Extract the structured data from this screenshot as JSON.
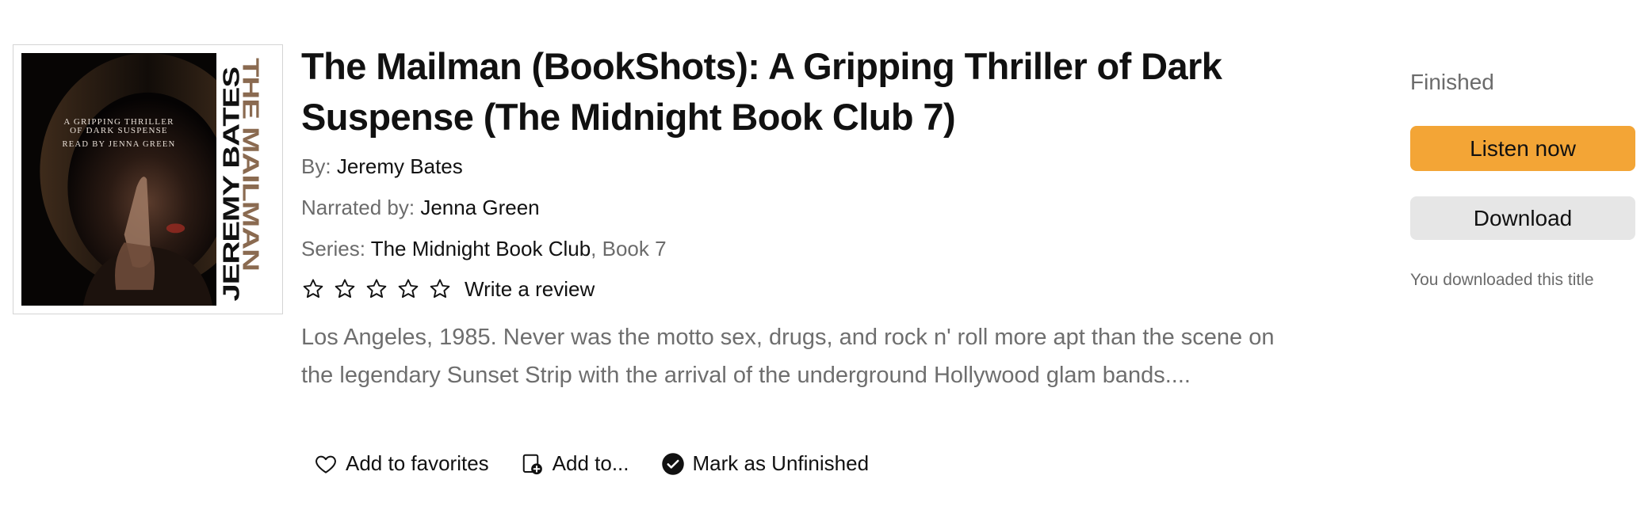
{
  "cover": {
    "tagline_line1": "A Gripping Thriller",
    "tagline_line2": "of Dark Suspense",
    "narrator_line": "Read by Jenna Green",
    "vertical_title": "The Mailman",
    "vertical_author": "Jeremy Bates"
  },
  "book": {
    "title": "The Mailman (BookShots): A Gripping Thriller of Dark Suspense (The Midnight Book Club 7)",
    "author_label": "By:",
    "author": "Jeremy Bates",
    "narrator_label": "Narrated by:",
    "narrator": "Jenna Green",
    "series_label": "Series:",
    "series": "The Midnight Book Club",
    "series_book": ", Book 7",
    "rating": {
      "filled_stars": 0,
      "max_stars": 5
    },
    "write_review_label": "Write a review",
    "summary": "Los Angeles, 1985. Never was the motto sex, drugs, and rock n' roll more apt than the scene on the legendary Sunset Strip with the arrival of the underground Hollywood glam bands...."
  },
  "actions": {
    "favorites_label": "Add to favorites",
    "add_to_label": "Add to...",
    "mark_label": "Mark as Unfinished"
  },
  "panel": {
    "status": "Finished",
    "listen_label": "Listen now",
    "download_label": "Download",
    "downloaded_note": "You downloaded this title"
  },
  "colors": {
    "listen_button": "#f3a536",
    "download_button": "#e6e6e6",
    "secondary_text": "#6b6b6b",
    "cover_title": "#8a6a50"
  },
  "icons": {
    "star": "star-outline-icon",
    "favorites": "heart-outline-icon",
    "add_to": "add-to-library-icon",
    "mark": "check-circle-icon"
  }
}
